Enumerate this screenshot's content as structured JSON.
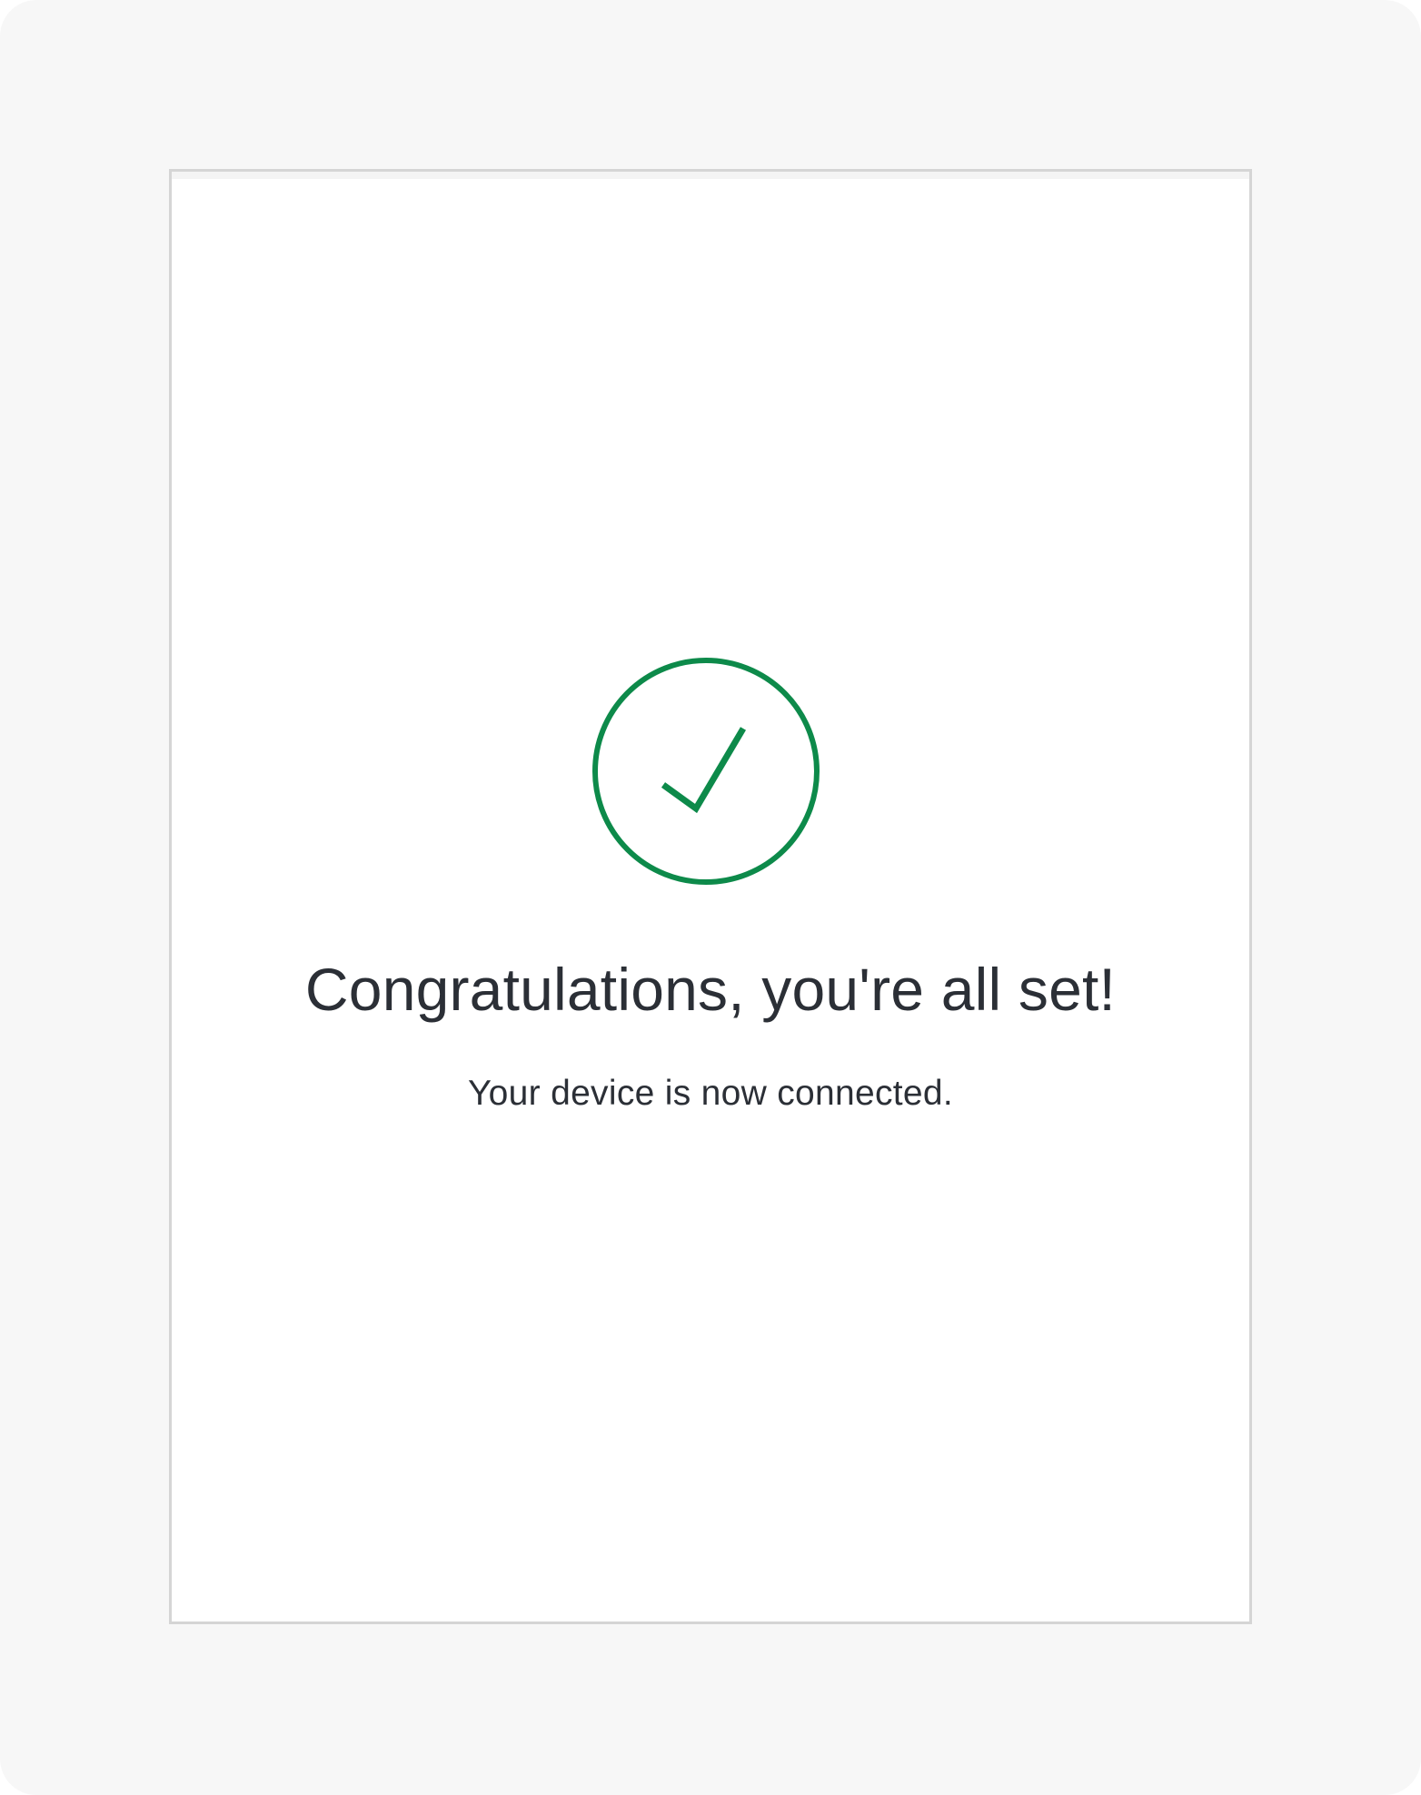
{
  "success": {
    "icon": "checkmark-circle-icon",
    "accent_color": "#0d8a4a",
    "title": "Congratulations, you're all set!",
    "message": "Your device is now connected."
  }
}
